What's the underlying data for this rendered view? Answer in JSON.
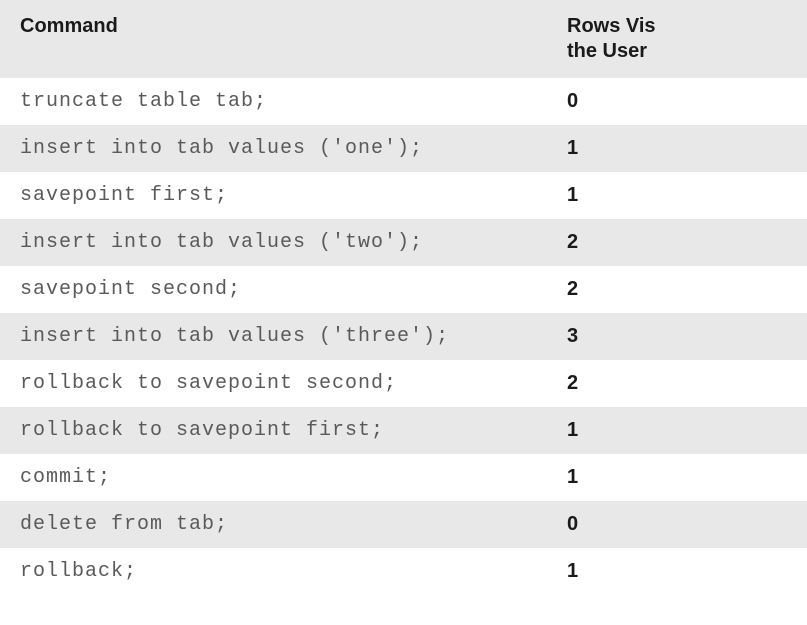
{
  "headers": {
    "command": "Command",
    "rows_visible_line1": "Rows Vis",
    "rows_visible_line2": "the User"
  },
  "rows": [
    {
      "command": "truncate table tab;",
      "value": "0"
    },
    {
      "command": "insert into tab values ('one');",
      "value": "1"
    },
    {
      "command": "savepoint first;",
      "value": "1"
    },
    {
      "command": "insert into tab values ('two');",
      "value": "2"
    },
    {
      "command": "savepoint second;",
      "value": "2"
    },
    {
      "command": "insert into tab values ('three');",
      "value": "3"
    },
    {
      "command": "rollback to savepoint second;",
      "value": "2"
    },
    {
      "command": "rollback to savepoint first;",
      "value": "1"
    },
    {
      "command": "commit;",
      "value": "1"
    },
    {
      "command": "delete from tab;",
      "value": "0"
    },
    {
      "command": "rollback;",
      "value": "1"
    }
  ]
}
